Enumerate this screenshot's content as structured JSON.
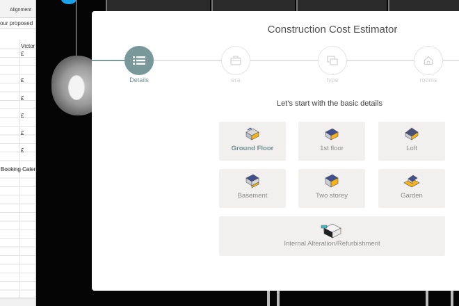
{
  "spreadsheet": {
    "ribbon_label": "Alignment",
    "formula_text": "our proposed",
    "column_header": "Victor",
    "currency_symbol": "£",
    "sheet_text": "Booking Caler"
  },
  "estimator": {
    "title": "Construction Cost Estimator",
    "steps": [
      {
        "label": "Details",
        "icon": "list-icon",
        "active": true
      },
      {
        "label": "era",
        "icon": "briefcase-icon",
        "active": false
      },
      {
        "label": "type",
        "icon": "stack-icon",
        "active": false
      },
      {
        "label": "rooms",
        "icon": "house-icon",
        "active": false
      }
    ],
    "subtitle": "Let's start with the basic details",
    "options": [
      {
        "label": "Ground Floor",
        "icon": "ground-floor-icon",
        "selected": true
      },
      {
        "label": "1st floor",
        "icon": "first-floor-icon",
        "selected": false
      },
      {
        "label": "Loft",
        "icon": "loft-icon",
        "selected": false
      },
      {
        "label": "Basement",
        "icon": "basement-icon",
        "selected": false
      },
      {
        "label": "Two storey",
        "icon": "two-storey-icon",
        "selected": false
      },
      {
        "label": "Garden",
        "icon": "garden-icon",
        "selected": false
      },
      {
        "label": "Internal Alteration/Refurbishment",
        "icon": "refurbishment-icon",
        "selected": false
      }
    ],
    "colors": {
      "accent": "#78989a",
      "tile_background": "#f1f0ee",
      "icon_orange": "#f5b21a",
      "icon_blue": "#3f4f8f"
    }
  }
}
